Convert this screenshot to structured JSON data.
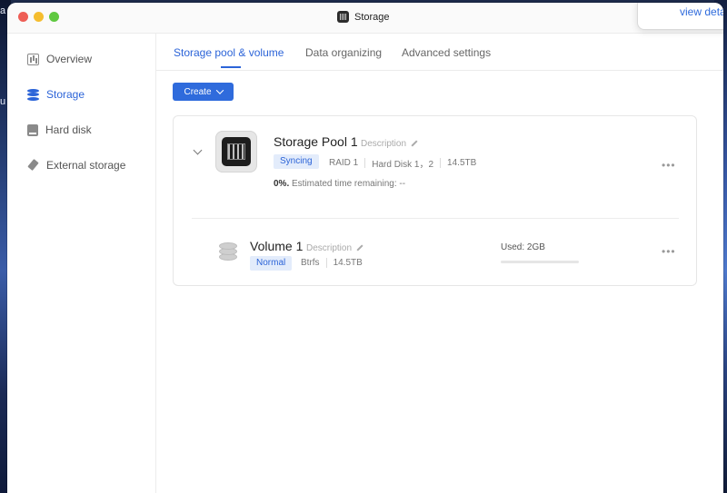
{
  "window": {
    "title": "Storage"
  },
  "popover": {
    "link": "view details"
  },
  "sidebar": {
    "items": [
      {
        "label": "Overview"
      },
      {
        "label": "Storage"
      },
      {
        "label": "Hard disk"
      },
      {
        "label": "External storage"
      }
    ],
    "active": "Storage"
  },
  "tabs": [
    {
      "label": "Storage pool & volume"
    },
    {
      "label": "Data organizing"
    },
    {
      "label": "Advanced settings"
    }
  ],
  "toolbar": {
    "create_label": "Create"
  },
  "pool": {
    "name": "Storage Pool 1",
    "description": "Description",
    "status": "Syncing",
    "raid": "RAID 1",
    "disks": "Hard Disk 1，2",
    "capacity": "14.5TB",
    "progress_percent": "0%.",
    "progress_text": "Estimated time remaining: --"
  },
  "volume": {
    "name": "Volume 1",
    "description": "Description",
    "status": "Normal",
    "filesystem": "Btrfs",
    "capacity": "14.5TB",
    "used_label": "Used: 2GB",
    "used_fraction": 0.0
  },
  "colors": {
    "accent": "#2f6bdc",
    "badge_bg": "#e3ecfb"
  }
}
